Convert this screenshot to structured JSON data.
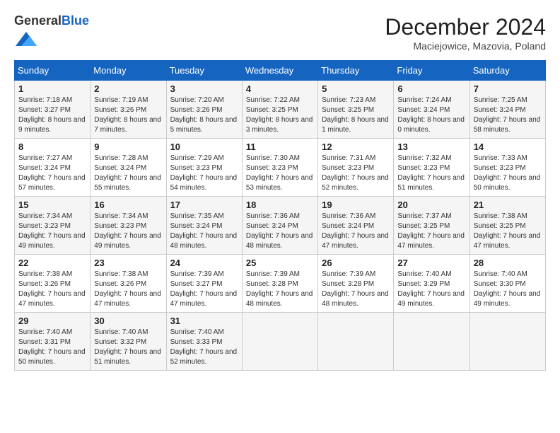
{
  "header": {
    "logo_general": "General",
    "logo_blue": "Blue",
    "month_title": "December 2024",
    "location": "Maciejowice, Mazovia, Poland"
  },
  "weekdays": [
    "Sunday",
    "Monday",
    "Tuesday",
    "Wednesday",
    "Thursday",
    "Friday",
    "Saturday"
  ],
  "weeks": [
    [
      {
        "day": "1",
        "sunrise": "7:18 AM",
        "sunset": "3:27 PM",
        "daylight": "8 hours and 9 minutes."
      },
      {
        "day": "2",
        "sunrise": "7:19 AM",
        "sunset": "3:26 PM",
        "daylight": "8 hours and 7 minutes."
      },
      {
        "day": "3",
        "sunrise": "7:20 AM",
        "sunset": "3:26 PM",
        "daylight": "8 hours and 5 minutes."
      },
      {
        "day": "4",
        "sunrise": "7:22 AM",
        "sunset": "3:25 PM",
        "daylight": "8 hours and 3 minutes."
      },
      {
        "day": "5",
        "sunrise": "7:23 AM",
        "sunset": "3:25 PM",
        "daylight": "8 hours and 1 minute."
      },
      {
        "day": "6",
        "sunrise": "7:24 AM",
        "sunset": "3:24 PM",
        "daylight": "8 hours and 0 minutes."
      },
      {
        "day": "7",
        "sunrise": "7:25 AM",
        "sunset": "3:24 PM",
        "daylight": "7 hours and 58 minutes."
      }
    ],
    [
      {
        "day": "8",
        "sunrise": "7:27 AM",
        "sunset": "3:24 PM",
        "daylight": "7 hours and 57 minutes."
      },
      {
        "day": "9",
        "sunrise": "7:28 AM",
        "sunset": "3:24 PM",
        "daylight": "7 hours and 55 minutes."
      },
      {
        "day": "10",
        "sunrise": "7:29 AM",
        "sunset": "3:23 PM",
        "daylight": "7 hours and 54 minutes."
      },
      {
        "day": "11",
        "sunrise": "7:30 AM",
        "sunset": "3:23 PM",
        "daylight": "7 hours and 53 minutes."
      },
      {
        "day": "12",
        "sunrise": "7:31 AM",
        "sunset": "3:23 PM",
        "daylight": "7 hours and 52 minutes."
      },
      {
        "day": "13",
        "sunrise": "7:32 AM",
        "sunset": "3:23 PM",
        "daylight": "7 hours and 51 minutes."
      },
      {
        "day": "14",
        "sunrise": "7:33 AM",
        "sunset": "3:23 PM",
        "daylight": "7 hours and 50 minutes."
      }
    ],
    [
      {
        "day": "15",
        "sunrise": "7:34 AM",
        "sunset": "3:23 PM",
        "daylight": "7 hours and 49 minutes."
      },
      {
        "day": "16",
        "sunrise": "7:34 AM",
        "sunset": "3:23 PM",
        "daylight": "7 hours and 49 minutes."
      },
      {
        "day": "17",
        "sunrise": "7:35 AM",
        "sunset": "3:24 PM",
        "daylight": "7 hours and 48 minutes."
      },
      {
        "day": "18",
        "sunrise": "7:36 AM",
        "sunset": "3:24 PM",
        "daylight": "7 hours and 48 minutes."
      },
      {
        "day": "19",
        "sunrise": "7:36 AM",
        "sunset": "3:24 PM",
        "daylight": "7 hours and 47 minutes."
      },
      {
        "day": "20",
        "sunrise": "7:37 AM",
        "sunset": "3:25 PM",
        "daylight": "7 hours and 47 minutes."
      },
      {
        "day": "21",
        "sunrise": "7:38 AM",
        "sunset": "3:25 PM",
        "daylight": "7 hours and 47 minutes."
      }
    ],
    [
      {
        "day": "22",
        "sunrise": "7:38 AM",
        "sunset": "3:26 PM",
        "daylight": "7 hours and 47 minutes."
      },
      {
        "day": "23",
        "sunrise": "7:38 AM",
        "sunset": "3:26 PM",
        "daylight": "7 hours and 47 minutes."
      },
      {
        "day": "24",
        "sunrise": "7:39 AM",
        "sunset": "3:27 PM",
        "daylight": "7 hours and 47 minutes."
      },
      {
        "day": "25",
        "sunrise": "7:39 AM",
        "sunset": "3:28 PM",
        "daylight": "7 hours and 48 minutes."
      },
      {
        "day": "26",
        "sunrise": "7:39 AM",
        "sunset": "3:28 PM",
        "daylight": "7 hours and 48 minutes."
      },
      {
        "day": "27",
        "sunrise": "7:40 AM",
        "sunset": "3:29 PM",
        "daylight": "7 hours and 49 minutes."
      },
      {
        "day": "28",
        "sunrise": "7:40 AM",
        "sunset": "3:30 PM",
        "daylight": "7 hours and 49 minutes."
      }
    ],
    [
      {
        "day": "29",
        "sunrise": "7:40 AM",
        "sunset": "3:31 PM",
        "daylight": "7 hours and 50 minutes."
      },
      {
        "day": "30",
        "sunrise": "7:40 AM",
        "sunset": "3:32 PM",
        "daylight": "7 hours and 51 minutes."
      },
      {
        "day": "31",
        "sunrise": "7:40 AM",
        "sunset": "3:33 PM",
        "daylight": "7 hours and 52 minutes."
      },
      null,
      null,
      null,
      null
    ]
  ]
}
